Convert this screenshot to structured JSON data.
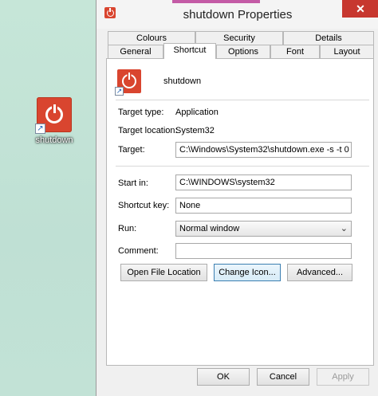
{
  "desktop": {
    "icon_label": "shutdown"
  },
  "window": {
    "title": "shutdown Properties",
    "close_glyph": "✕"
  },
  "tabs": {
    "row1": [
      "Colours",
      "Security",
      "Details"
    ],
    "row2": [
      "General",
      "Shortcut",
      "Options",
      "Font",
      "Layout"
    ],
    "active": "Shortcut"
  },
  "shortcut": {
    "name": "shutdown",
    "target_type_label": "Target type:",
    "target_type_value": "Application",
    "target_location_label": "Target location:",
    "target_location_value": "System32",
    "target_label": "Target:",
    "target_value": "C:\\Windows\\System32\\shutdown.exe -s -t 0",
    "start_in_label": "Start in:",
    "start_in_value": "C:\\WINDOWS\\system32",
    "shortcut_key_label": "Shortcut key:",
    "shortcut_key_value": "None",
    "run_label": "Run:",
    "run_value": "Normal window",
    "comment_label": "Comment:",
    "comment_value": ""
  },
  "buttons": {
    "open_file_location": "Open File Location",
    "change_icon": "Change Icon...",
    "advanced": "Advanced...",
    "ok": "OK",
    "cancel": "Cancel",
    "apply": "Apply"
  },
  "colors": {
    "accent": "#d9452f",
    "close": "#c7372f",
    "desktop": "#bfe0d2"
  },
  "icons": [
    "power-icon",
    "shortcut-arrow-icon",
    "close-icon",
    "chevron-down-icon"
  ]
}
